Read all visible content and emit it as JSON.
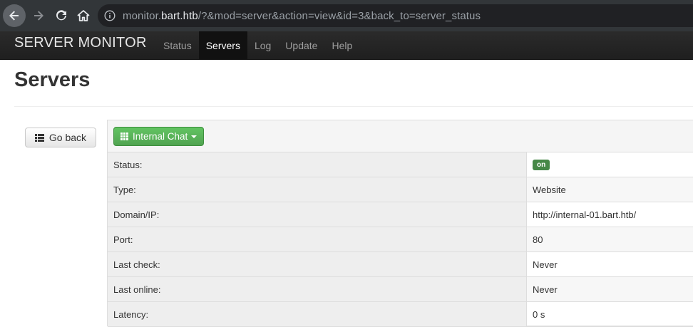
{
  "browser": {
    "url_host_prefix": "monitor.",
    "url_host": "bart.htb",
    "url_path": "/?&mod=server&action=view&id=3&back_to=server_status",
    "icons": {
      "back": "arrow-left-icon",
      "forward": "arrow-right-icon",
      "reload": "reload-icon",
      "home": "home-icon",
      "info": "info-icon"
    }
  },
  "navbar": {
    "brand": "SERVER MONITOR",
    "links": [
      "Status",
      "Servers",
      "Log",
      "Update",
      "Help"
    ],
    "active": "Servers"
  },
  "page": {
    "title": "Servers",
    "go_back_label": "Go back"
  },
  "server": {
    "name": "Internal Chat",
    "rows": [
      {
        "label": "Status:",
        "value": "on"
      },
      {
        "label": "Type:",
        "value": "Website"
      },
      {
        "label": "Domain/IP:",
        "value": "http://internal-01.bart.htb/"
      },
      {
        "label": "Port:",
        "value": "80"
      },
      {
        "label": "Last check:",
        "value": "Never"
      },
      {
        "label": "Last online:",
        "value": "Never"
      },
      {
        "label": "Latency:",
        "value": "0 s"
      }
    ]
  },
  "colors": {
    "status_on": "#468847",
    "server_button": "#51a351",
    "navbar": "#222222"
  }
}
